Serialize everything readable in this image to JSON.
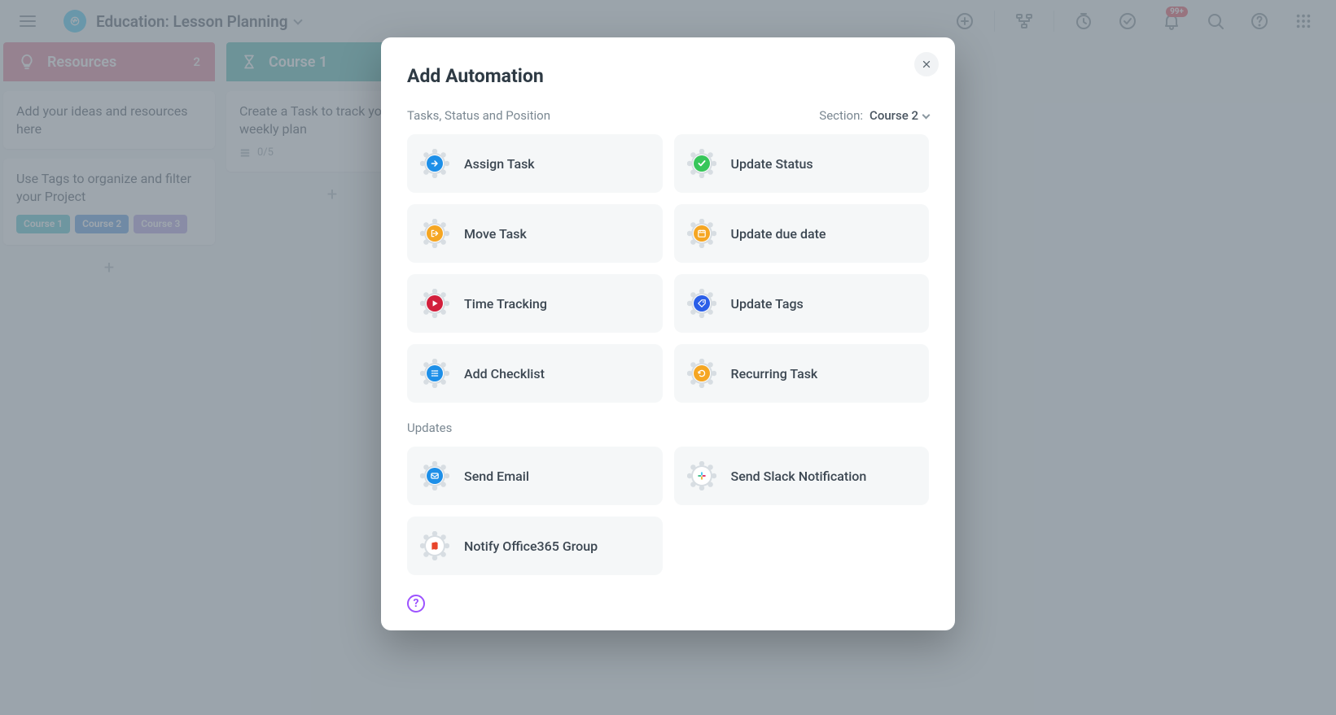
{
  "header": {
    "project_title": "Education: Lesson Planning",
    "notification_badge": "99+"
  },
  "board": {
    "columns": [
      {
        "id": "resources",
        "title": "Resources",
        "count": "2",
        "color": "pink",
        "cards": [
          {
            "text": "Add your ideas and resources here"
          },
          {
            "text": "Use Tags to organize and filter your Project",
            "tags": [
              "Course 1",
              "Course 2",
              "Course 3"
            ]
          }
        ]
      },
      {
        "id": "course1",
        "title": "Course 1",
        "color": "teal",
        "cards": [
          {
            "text": "Create a Task to track your weekly plan",
            "progress": "0/5"
          }
        ]
      }
    ]
  },
  "modal": {
    "title": "Add Automation",
    "group1_label": "Tasks, Status and Position",
    "section_label": "Section:",
    "section_value": "Course 2",
    "group2_label": "Updates",
    "help_tooltip": "?",
    "options_group1": [
      {
        "id": "assign-task",
        "label": "Assign Task",
        "color": "#1d8fe8",
        "icon": "arrow-right"
      },
      {
        "id": "update-status",
        "label": "Update Status",
        "color": "#37c65a",
        "icon": "check"
      },
      {
        "id": "move-task",
        "label": "Move Task",
        "color": "#f5a623",
        "icon": "exit"
      },
      {
        "id": "update-due-date",
        "label": "Update due date",
        "color": "#f5a623",
        "icon": "calendar"
      },
      {
        "id": "time-tracking",
        "label": "Time Tracking",
        "color": "#d21f3c",
        "icon": "play"
      },
      {
        "id": "update-tags",
        "label": "Update Tags",
        "color": "#2b5fe8",
        "icon": "tag"
      },
      {
        "id": "add-checklist",
        "label": "Add Checklist",
        "color": "#1d8fe8",
        "icon": "list"
      },
      {
        "id": "recurring-task",
        "label": "Recurring Task",
        "color": "#f5a623",
        "icon": "refresh"
      }
    ],
    "options_group2": [
      {
        "id": "send-email",
        "label": "Send Email",
        "color": "#1d8fe8",
        "icon": "mail"
      },
      {
        "id": "send-slack",
        "label": "Send Slack Notification",
        "color": "multi",
        "icon": "slack"
      },
      {
        "id": "notify-o365",
        "label": "Notify Office365 Group",
        "color": "#e8452b",
        "icon": "office"
      }
    ]
  }
}
